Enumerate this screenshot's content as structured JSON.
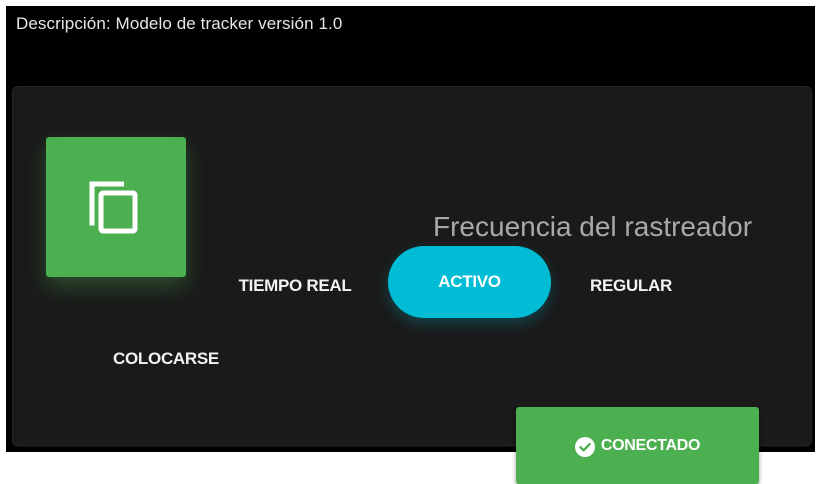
{
  "header": {
    "description": "Descripción: Modelo de tracker versión 1.0"
  },
  "tile": {
    "icon": "copy-icon"
  },
  "tracker": {
    "title": "Frecuencia del rastreador",
    "options": [
      {
        "label": "TIEMPO REAL",
        "selected": false
      },
      {
        "label": "ACTIVO",
        "selected": true
      },
      {
        "label": "REGULAR",
        "selected": false
      },
      {
        "label": "COLOCARSE",
        "selected": false
      }
    ]
  },
  "status_button": {
    "label": "CONECTADO",
    "icon": "check-circle-icon"
  },
  "colors": {
    "tile": "#4caf50",
    "selected_option": "#00bcd4",
    "status_button": "#4caf50",
    "card_background": "#1a1a1a"
  }
}
